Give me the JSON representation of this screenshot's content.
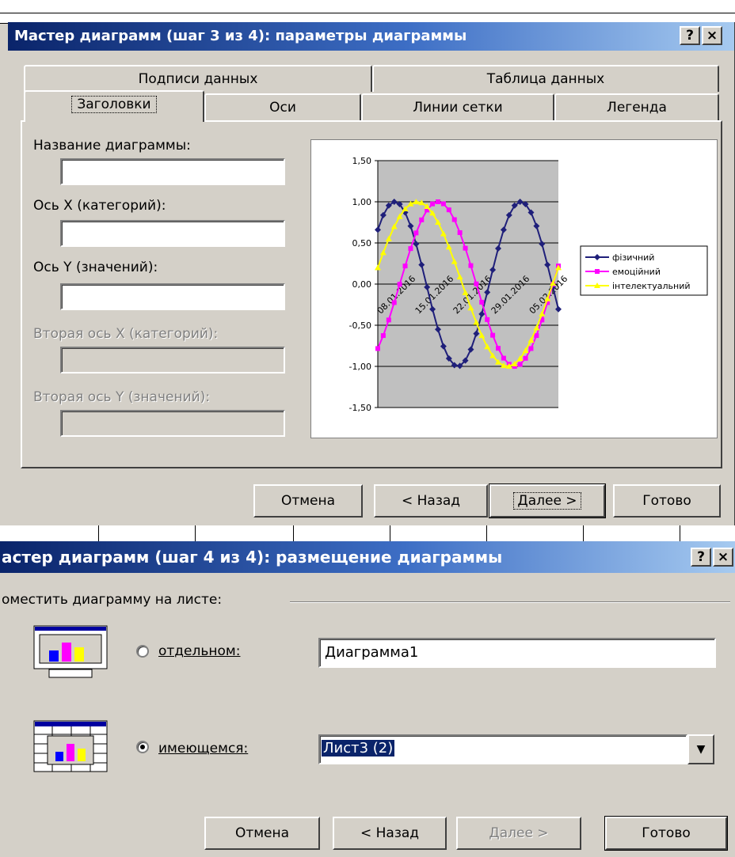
{
  "wizard_step3": {
    "title": "Мастер диаграмм (шаг 3 из 4): параметры диаграммы",
    "help_btn": "?",
    "close_btn": "×",
    "tabs_back": [
      "Подписи данных",
      "Таблица данных"
    ],
    "tabs_front": [
      "Заголовки",
      "Оси",
      "Линии сетки",
      "Легенда"
    ],
    "active_tab": "Заголовки",
    "fields": {
      "chart_title_label": "Название диаграммы:",
      "chart_title_value": "",
      "x_axis_label": "Ось X (категорий):",
      "x_axis_value": "",
      "y_axis_label": "Ось Y (значений):",
      "y_axis_value": "",
      "x2_axis_label": "Вторая ось X (категорий):",
      "y2_axis_label": "Вторая ось Y (значений):"
    },
    "buttons": {
      "cancel": "Отмена",
      "back": "< Назад",
      "next": "Далее >",
      "finish": "Готово"
    }
  },
  "wizard_step4": {
    "title": "астер диаграмм (шаг 4 из 4): размещение диаграммы",
    "help_btn": "?",
    "close_btn": "×",
    "group_label": "оместить диаграмму на листе:",
    "option_separate_label": "отдельном:",
    "option_separate_value": "Диаграмма1",
    "option_existing_label": "имеющемся:",
    "option_existing_value": "Лист3 (2)",
    "selected_option": "existing",
    "buttons": {
      "cancel": "Отмена",
      "back": "< Назад",
      "next": "Далее >",
      "finish": "Готово"
    }
  },
  "chart_data": {
    "type": "line",
    "title": "",
    "y_tick_labels": [
      "1,50",
      "1,00",
      "0,50",
      "0,00",
      "-0,50",
      "-1,00",
      "-1,50"
    ],
    "ylim": [
      -1.5,
      1.5
    ],
    "x_tick_labels": [
      "08.01.2016",
      "15.01.2016",
      "22.01.2016",
      "29.01.2016",
      "05.02.2016"
    ],
    "grid": true,
    "legend_position": "right",
    "series": [
      {
        "name": "фізичний",
        "color": "#1f1f7a",
        "marker": "diamond",
        "period_days": 23,
        "phase": 0.72,
        "points": 34
      },
      {
        "name": "емоційний",
        "color": "#ff00ff",
        "marker": "square",
        "period_days": 28,
        "phase": -0.9,
        "points": 34
      },
      {
        "name": "інтелектуальний",
        "color": "#ffff00",
        "marker": "triangle",
        "period_days": 33,
        "phase": 0.2,
        "points": 34
      }
    ]
  }
}
